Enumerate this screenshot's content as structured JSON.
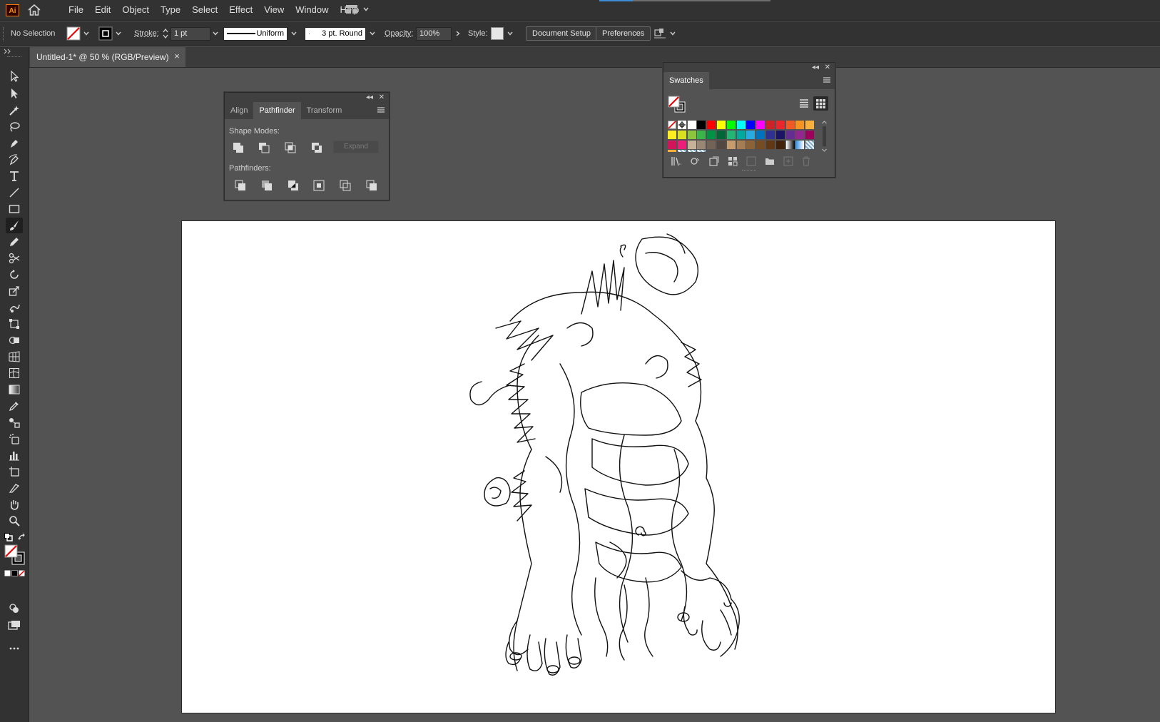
{
  "app": {
    "logo_text": "Ai"
  },
  "menu": [
    "File",
    "Edit",
    "Object",
    "Type",
    "Select",
    "Effect",
    "View",
    "Window",
    "Help"
  ],
  "control": {
    "selection": "No Selection",
    "stroke_label": "Stroke:",
    "stroke_value": "1 pt",
    "profile": "Uniform",
    "brush": "3 pt. Round",
    "opacity_label": "Opacity:",
    "opacity_value": "100%",
    "style_label": "Style:",
    "document_setup": "Document Setup",
    "preferences": "Preferences"
  },
  "document": {
    "tab_title": "Untitled-1* @ 50 % (RGB/Preview)",
    "close": "×"
  },
  "pathfinder_panel": {
    "tabs": [
      "Align",
      "Pathfinder",
      "Transform"
    ],
    "active_tab": "Pathfinder",
    "shape_modes_label": "Shape Modes:",
    "pathfinders_label": "Pathfinders:",
    "expand_label": "Expand"
  },
  "swatches_panel": {
    "title": "Swatches",
    "rows": [
      [
        "none",
        "reg",
        "#ffffff",
        "#000000",
        "#ff0000",
        "#ffff00",
        "#00ff00",
        "#00ffff",
        "#0000ff",
        "#ff00ff",
        "#cc2229",
        "#e8262b",
        "#f15a24",
        "#f7931e",
        "#fbb03b"
      ],
      [
        "#fcee21",
        "#d9e021",
        "#8cc63f",
        "#39b54a",
        "#009245",
        "#006837",
        "#22b573",
        "#00a99d",
        "#29abe2",
        "#0071bc",
        "#2e3192",
        "#1b1464",
        "#662d91",
        "#93278f",
        "#9e005d"
      ],
      [
        "#d4145a",
        "#ed1e79",
        "#c7b299",
        "#998675",
        "#736357",
        "#534741",
        "#c69c6d",
        "#a67c52",
        "#8c6239",
        "#754c24",
        "#603813",
        "#42210b",
        "#gradient_bw",
        "#gradient_blue",
        "#pattern"
      ],
      [
        "#fbb03b",
        "#pattern2",
        "#pattern3",
        "#pattern4"
      ]
    ]
  },
  "colors": {
    "menubar": "#323232",
    "workspace": "#535353",
    "panel": "#535353",
    "accent": "#3e8bd6"
  }
}
